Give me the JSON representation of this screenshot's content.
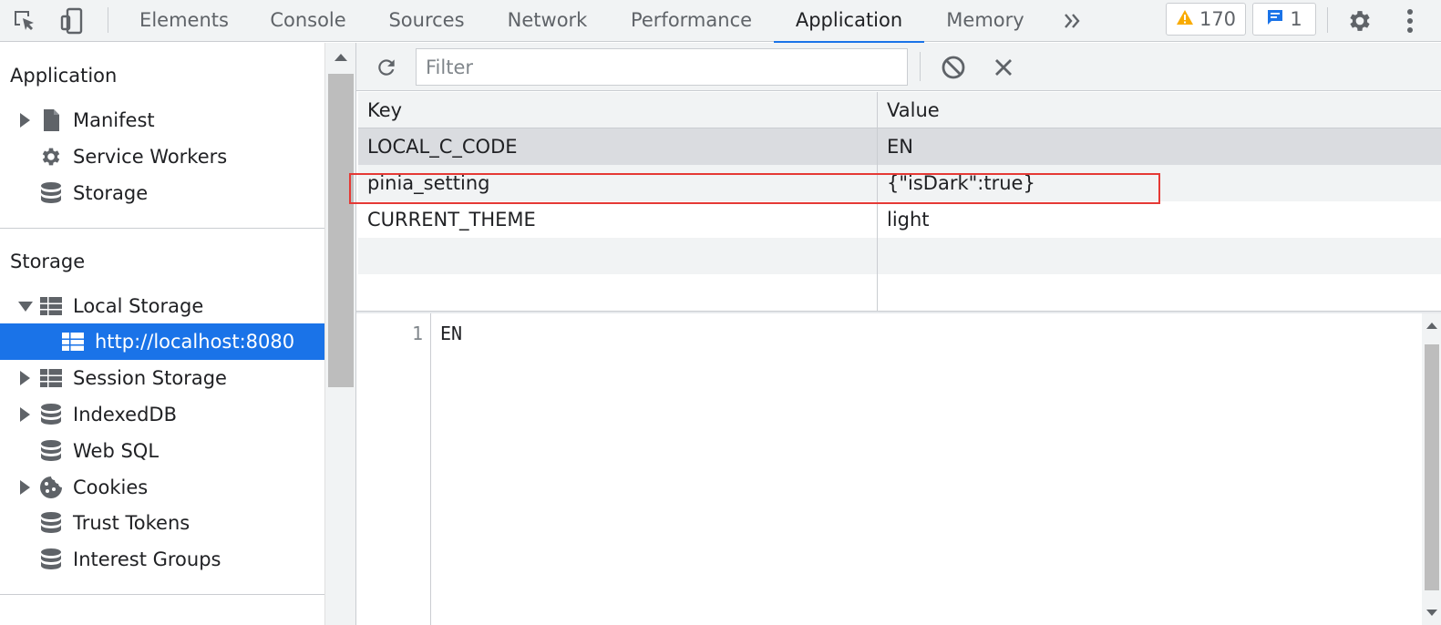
{
  "tabs": [
    {
      "label": "Elements"
    },
    {
      "label": "Console"
    },
    {
      "label": "Sources"
    },
    {
      "label": "Network"
    },
    {
      "label": "Performance"
    },
    {
      "label": "Application",
      "active": true
    },
    {
      "label": "Memory"
    }
  ],
  "toolbar_badges": {
    "warnings": "170",
    "messages": "1"
  },
  "sidebar": {
    "application_title": "Application",
    "application_items": [
      {
        "label": "Manifest",
        "icon": "document-icon",
        "expandable": true
      },
      {
        "label": "Service Workers",
        "icon": "gear-icon"
      },
      {
        "label": "Storage",
        "icon": "database-icon"
      }
    ],
    "storage_title": "Storage",
    "storage_items": [
      {
        "label": "Local Storage",
        "icon": "table-icon",
        "expanded": true
      },
      {
        "label": "http://localhost:8080",
        "icon": "table-icon",
        "selected": true
      },
      {
        "label": "Session Storage",
        "icon": "table-icon",
        "expandable": true
      },
      {
        "label": "IndexedDB",
        "icon": "database-icon",
        "expandable": true
      },
      {
        "label": "Web SQL",
        "icon": "database-icon"
      },
      {
        "label": "Cookies",
        "icon": "cookie-icon",
        "expandable": true
      },
      {
        "label": "Trust Tokens",
        "icon": "database-icon"
      },
      {
        "label": "Interest Groups",
        "icon": "database-icon"
      }
    ]
  },
  "filter": {
    "placeholder": "Filter"
  },
  "grid": {
    "headers": {
      "key": "Key",
      "value": "Value"
    },
    "rows": [
      {
        "key": "LOCAL_C_CODE",
        "value": "EN"
      },
      {
        "key": "pinia_setting",
        "value": "{\"isDark\":true}"
      },
      {
        "key": "CURRENT_THEME",
        "value": "light"
      }
    ]
  },
  "preview": {
    "line_number": "1",
    "content": "EN"
  },
  "colors": {
    "accent": "#1a73e8",
    "highlight_border": "#e53935",
    "warning": "#f9ab00"
  }
}
